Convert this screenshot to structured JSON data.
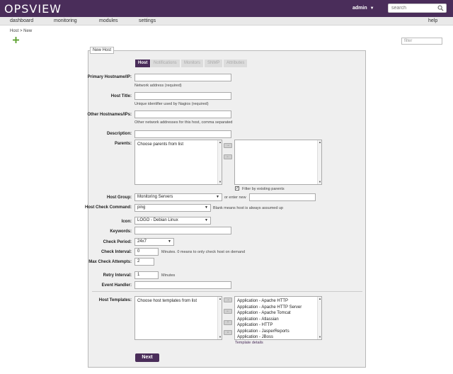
{
  "header": {
    "logo": "OPSVIEW",
    "user": "admin",
    "search_placeholder": "search"
  },
  "nav": {
    "items": [
      "dashboard",
      "monitoring",
      "modules",
      "settings"
    ],
    "help": "help"
  },
  "breadcrumb": "Host > New",
  "filter_placeholder": "filter",
  "panel": {
    "legend": "New Host",
    "tabs": [
      "Host",
      "Notifications",
      "Monitors",
      "SNMP",
      "Attributes"
    ],
    "active_tab": "Host"
  },
  "form": {
    "primary_hostname_label": "Primary Hostname/IP:",
    "primary_hostname_help": "Network address (required)",
    "host_title_label": "Host Title:",
    "host_title_help": "Unique identifier used by Nagios (required)",
    "other_hostnames_label": "Other Hostnames/IPs:",
    "other_hostnames_help": "Other network addresses for this host, comma separated",
    "description_label": "Description:",
    "parents_label": "Parents:",
    "parents_placeholder": "Choose parents from list",
    "filter_existing": "Filter by existing parents",
    "host_group_label": "Host Group:",
    "host_group_value": "Monitoring Servers",
    "or_enter_new": "or enter new",
    "host_check_label": "Host Check Command:",
    "host_check_value": "ping",
    "host_check_help": "Blank means host is always assumed up",
    "icon_label": "Icon:",
    "icon_value": "LOGO - Debian Linux",
    "keywords_label": "Keywords:",
    "check_period_label": "Check Period:",
    "check_period_value": "24x7",
    "check_interval_label": "Check Interval:",
    "check_interval_value": "0",
    "check_interval_help": "Minutes. 0 means to only check host on demand",
    "max_attempts_label": "Max Check Attempts:",
    "max_attempts_value": "2",
    "retry_interval_label": "Retry Interval:",
    "retry_interval_value": "1",
    "retry_interval_help": "Minutes",
    "event_handler_label": "Event Handler:",
    "host_templates_label": "Host Templates:",
    "templates_placeholder": "Choose host templates from list",
    "templates": [
      "Application - Apache HTTP",
      "Application - Apache HTTP Server",
      "Application - Apache Tomcat",
      "Application - Atlassian",
      "Application - HTTP",
      "Application - JasperReports",
      "Application - JBoss"
    ],
    "template_details": "Template details",
    "next_label": "Next"
  },
  "colors": {
    "brand": "#4a2d5a",
    "panel_bg": "#efefef"
  }
}
